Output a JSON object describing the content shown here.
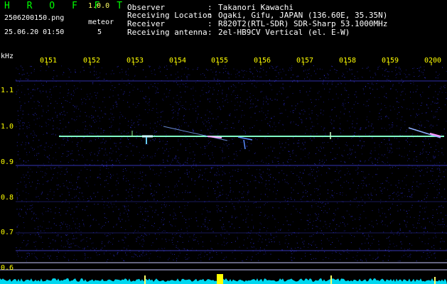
{
  "header": {
    "app_title": "H R O F F T",
    "app_version": "1.0.0",
    "file_name": "2506200150.png",
    "date_time": "25.06.20 01:50",
    "meteor_label": "meteor",
    "meteor_count": "5"
  },
  "info": {
    "separator": ":",
    "rows": [
      {
        "label": "Observer",
        "value": "Takanori Kawachi"
      },
      {
        "label": "Receiving Location",
        "value": "Ogaki, Gifu, JAPAN (136.60E, 35.35N)"
      },
      {
        "label": "Receiver",
        "value": "R820T2(RTL-SDR) SDR-Sharp 53.1000MHz"
      },
      {
        "label": "Receiving antenna",
        "value": "2el-HB9CV Vertical (el. E-W)"
      }
    ]
  },
  "axes": {
    "unit": "kHz",
    "time_ticks": [
      "0151",
      "0152",
      "0153",
      "0154",
      "0155",
      "0156",
      "0157",
      "0158",
      "0159",
      "0200"
    ],
    "freq_ticks": [
      "1.1",
      "1.0",
      "0.9",
      "0.8",
      "0.7",
      "0.6"
    ]
  },
  "colors": {
    "background": "#000000",
    "title": "#00ff00",
    "version": "#ffff66",
    "tick": "#ffff00",
    "noise": "#1a1a8c",
    "signal": "#66ffcc",
    "meteor": "#ccffff",
    "baseline": "#00e0ff"
  }
}
